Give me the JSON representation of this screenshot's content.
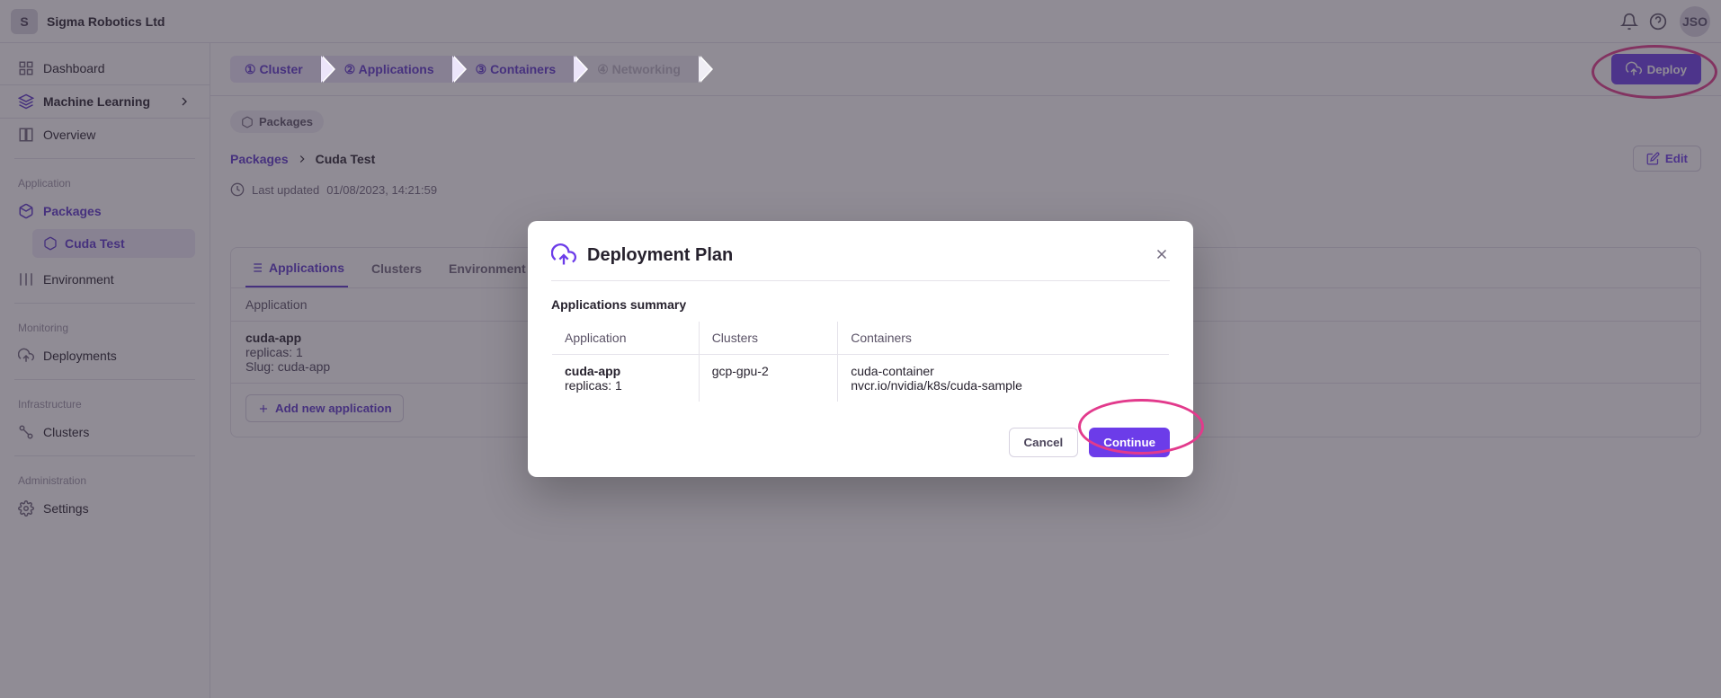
{
  "org": {
    "initial": "S",
    "name": "Sigma Robotics Ltd"
  },
  "user": {
    "initials": "JSO"
  },
  "sidebar": {
    "dashboard": "Dashboard",
    "ml": "Machine Learning",
    "overview": "Overview",
    "heading_app": "Application",
    "packages": "Packages",
    "package_active": "Cuda Test",
    "environment": "Environment",
    "heading_mon": "Monitoring",
    "deployments": "Deployments",
    "heading_infra": "Infrastructure",
    "clusters": "Clusters",
    "heading_admin": "Administration",
    "settings": "Settings"
  },
  "stepper": [
    "① Cluster",
    "② Applications",
    "③ Containers",
    "④ Networking"
  ],
  "deploy_label": "Deploy",
  "tag": "Packages",
  "crumbs": {
    "root": "Packages",
    "current": "Cuda Test"
  },
  "edit_label": "Edit",
  "updated": {
    "label": "Last updated",
    "value": "01/08/2023, 14:21:59"
  },
  "panel": {
    "tabs": {
      "applications": "Applications",
      "clusters": "Clusters",
      "env": "Environment variables"
    },
    "col_app": "Application",
    "app": {
      "name": "cuda-app",
      "replicas": "replicas: 1",
      "slug": "Slug: cuda-app"
    },
    "add": "Add new application"
  },
  "modal": {
    "title": "Deployment Plan",
    "section": "Applications summary",
    "cols": {
      "app": "Application",
      "clusters": "Clusters",
      "containers": "Containers"
    },
    "row": {
      "app_name": "cuda-app",
      "app_meta": "replicas: 1",
      "cluster": "gcp-gpu-2",
      "container_name": "cuda-container",
      "container_image": "nvcr.io/nvidia/k8s/cuda-sample"
    },
    "cancel": "Cancel",
    "continue": "Continue"
  }
}
